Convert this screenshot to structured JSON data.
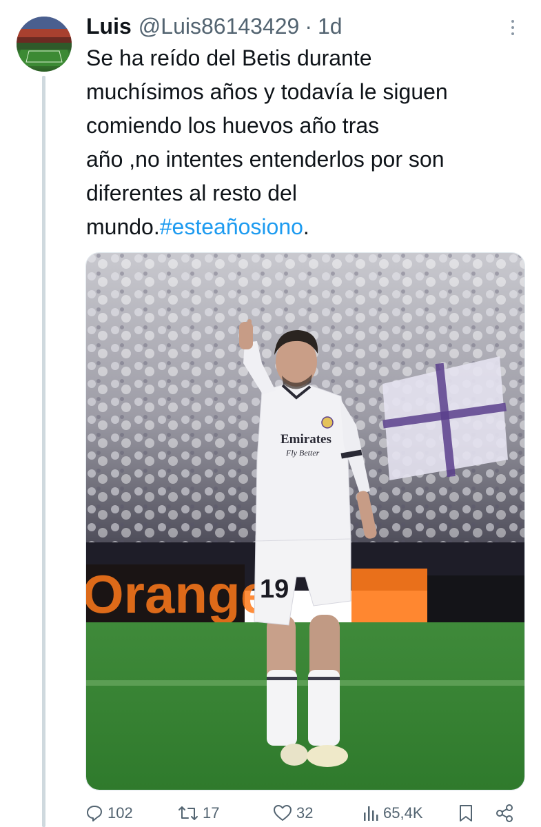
{
  "tweet": {
    "author_name": "Luis",
    "handle": "@Luis86143429",
    "separator": "·",
    "time": "1d",
    "text_lines": [
      "Se ha reído del Betis durante",
      "muchísimos años y todavía le siguen",
      "comiendo los huevos año tras",
      "año ,no intentes entenderlos por son",
      "diferentes al resto del"
    ],
    "last_line_prefix": "mundo.",
    "hashtag": "#esteañosiono",
    "last_line_suffix": ".",
    "media": {
      "player_number": "19",
      "sponsor_line1": "Emirates",
      "sponsor_line2": "Fly Better",
      "board_text": "Orange"
    }
  },
  "actions": {
    "replies": "102",
    "retweets": "17",
    "likes": "32",
    "views": "65,4K"
  },
  "colors": {
    "text": "#0f1419",
    "secondary": "#536471",
    "link": "#1d9bf0",
    "thread_line": "#cfd9de"
  }
}
